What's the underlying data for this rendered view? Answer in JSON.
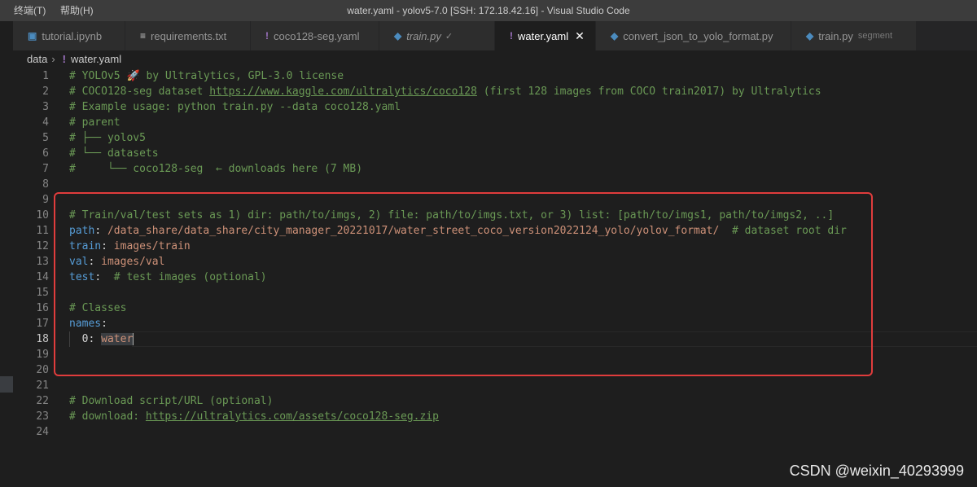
{
  "menu": {
    "terminal": "终端(T)",
    "help": "帮助(H)"
  },
  "window_title": "water.yaml - yolov5-7.0 [SSH: 172.18.42.16] - Visual Studio Code",
  "tabs": [
    {
      "label": "tutorial.ipynb",
      "icon": "notebook-icon"
    },
    {
      "label": "requirements.txt",
      "icon": "text-file-icon"
    },
    {
      "label": "coco128-seg.yaml",
      "icon": "yaml-icon"
    },
    {
      "label": "train.py",
      "icon": "python-icon",
      "status": "✓"
    },
    {
      "label": "water.yaml",
      "icon": "yaml-icon",
      "active": true
    },
    {
      "label": "convert_json_to_yolo_format.py",
      "icon": "python-icon"
    },
    {
      "label": "train.py",
      "icon": "python-icon",
      "description": "segment"
    }
  ],
  "breadcrumb": {
    "folder": "data",
    "file": "water.yaml"
  },
  "lines": {
    "l1": "# YOLOv5 🚀 by Ultralytics, GPL-3.0 license",
    "l2a": "# COCO128-seg dataset ",
    "l2b": "https://www.kaggle.com/ultralytics/coco128",
    "l2c": " (first 128 images from COCO train2017) by Ultralytics",
    "l3": "# Example usage: python train.py --data coco128.yaml",
    "l4": "# parent",
    "l5": "# ├── yolov5",
    "l6": "# └── datasets",
    "l7": "#     └── coco128-seg  ← downloads here (7 MB)",
    "l10": "# Train/val/test sets as 1) dir: path/to/imgs, 2) file: path/to/imgs.txt, or 3) list: [path/to/imgs1, path/to/imgs2, ..]",
    "l11_key": "path",
    "l11_val": "/data_share/data_share/city_manager_20221017/water_street_coco_version2022124_yolo/yolov_format/",
    "l11_cm": "# dataset root dir",
    "l12_key": "train",
    "l12_val": "images/train",
    "l13_key": "val",
    "l13_val": "images/val",
    "l14_key": "test",
    "l14_cm": "# test images (optional)",
    "l16": "# Classes",
    "l17_key": "names",
    "l18_key": "0",
    "l18_val": "water",
    "l22": "# Download script/URL (optional)",
    "l23a": "# download: ",
    "l23b": "https://ultralytics.com/assets/coco128-seg.zip"
  },
  "line_numbers": [
    "1",
    "2",
    "3",
    "4",
    "5",
    "6",
    "7",
    "8",
    "9",
    "10",
    "11",
    "12",
    "13",
    "14",
    "15",
    "16",
    "17",
    "18",
    "19",
    "20",
    "21",
    "22",
    "23",
    "24"
  ],
  "current_line": "18",
  "watermark": "CSDN @weixin_40293999",
  "colors": {
    "highlight_box": "#e03c3c",
    "comment": "#6a9955",
    "key": "#569cd6",
    "string": "#ce9178"
  }
}
